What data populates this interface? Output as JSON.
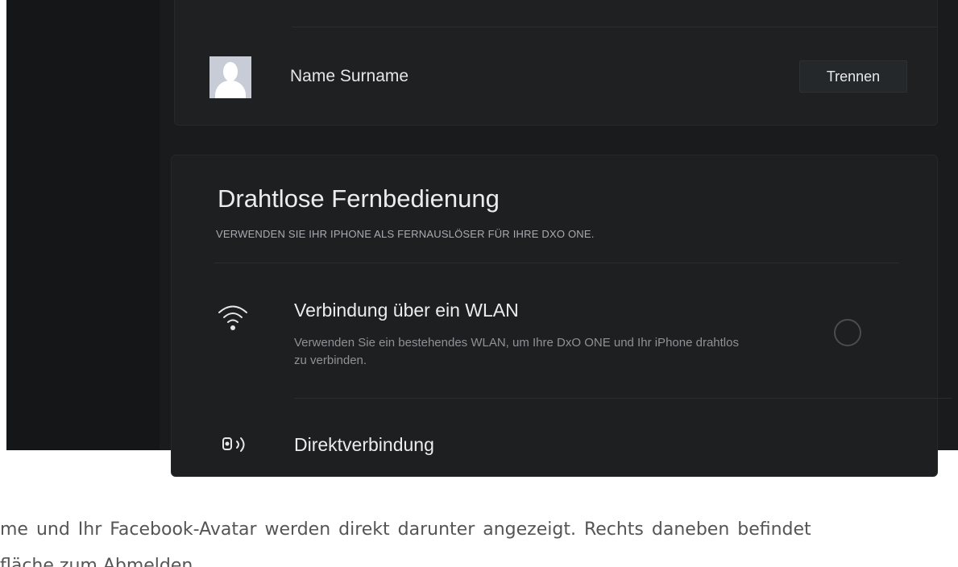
{
  "account": {
    "user_name": "Name Surname",
    "disconnect_label": "Trennen",
    "avatar_icon": "default-avatar-icon"
  },
  "remote": {
    "title": "Drahtlose Fernbedienung",
    "subtitle": "VERWENDEN SIE IHR IPHONE ALS FERNAUSLÖSER FÜR IHRE DXO ONE.",
    "options": [
      {
        "icon": "wifi-icon",
        "title": "Verbindung über ein WLAN",
        "description": "Verwenden Sie ein bestehendes WLAN, um Ihre DxO ONE und Ihr iPhone drahtlos zu verbinden."
      },
      {
        "icon": "direct-connection-icon",
        "title": "Direktverbindung"
      }
    ]
  },
  "article": {
    "line1": "me und Ihr Facebook-Avatar werden direkt darunter angezeigt. Rechts daneben befindet",
    "line2": "fläche zum Abmelden."
  },
  "colors": {
    "background": "#17191b",
    "card": "#1e2022",
    "text_light": "#ececec",
    "text_muted": "#8e9296",
    "article_text": "#555555"
  }
}
